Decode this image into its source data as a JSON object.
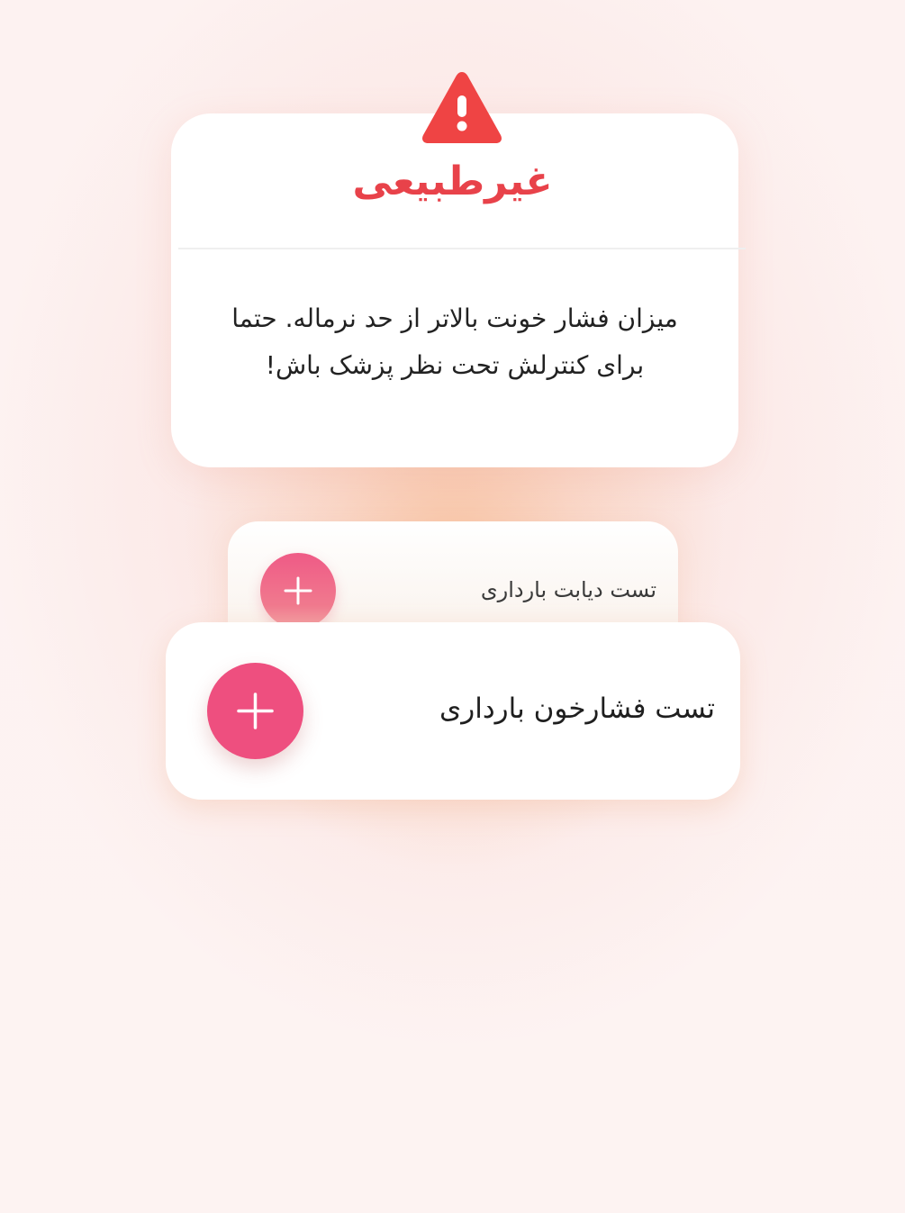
{
  "alert": {
    "icon": "warning-triangle-icon",
    "title": "غیرطبیعی",
    "message": "میزان فشار خونت بالاتر از حد نرماله. حتما برای کنترلش تحت نظر پزشک باش!",
    "title_color": "#e8424a",
    "icon_color": "#ef4444"
  },
  "cards": {
    "back": {
      "label": "تست دیابت بارداری",
      "button_icon": "plus-icon"
    },
    "front": {
      "label": "تست فشارخون بارداری",
      "button_icon": "plus-icon"
    }
  },
  "colors": {
    "accent": "#ee4f7f"
  }
}
